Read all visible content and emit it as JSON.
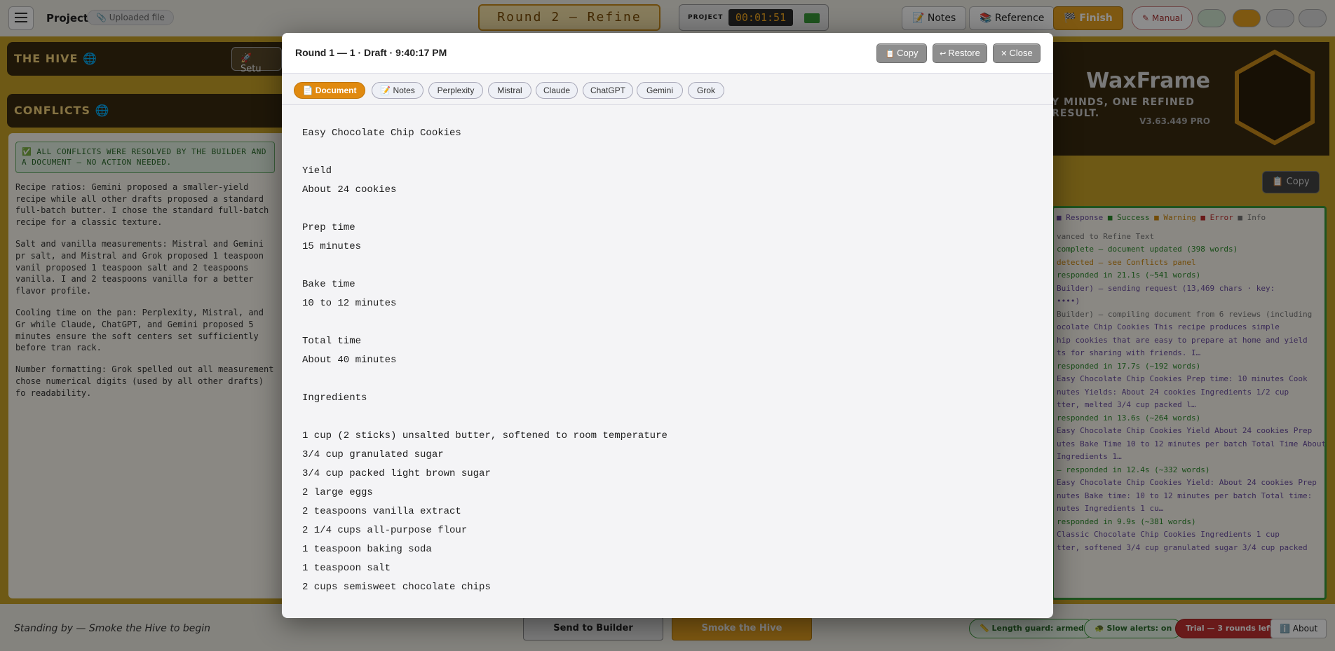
{
  "topbar": {
    "project_label": "Project",
    "uploaded_badge": "Uploaded file",
    "round_title": "Round 2 — Refine",
    "timer_label": "PROJECT",
    "timer_value": "00:01:51",
    "notes_label": "Notes",
    "reference_label": "Reference",
    "finish_label": "Finish",
    "manual_label": "Manual"
  },
  "left_panel": {
    "hive_title": "THE HIVE",
    "setup_label": "Setu",
    "conflicts_title": "CONFLICTS",
    "resolved_banner": "ALL CONFLICTS WERE RESOLVED BY THE BUILDER AND A DOCUMENT — NO ACTION NEEDED.",
    "paragraphs": [
      "Recipe ratios: Gemini proposed a smaller-yield recipe while all other drafts proposed a standard full-batch butter. I chose the standard full-batch recipe for a classic texture.",
      "Salt and vanilla measurements: Mistral and Gemini pr salt, and Mistral and Grok proposed 1 teaspoon vanil proposed 1 teaspoon salt and 2 teaspoons vanilla. I and 2 teaspoons vanilla for a better flavor profile.",
      "Cooling time on the pan: Perplexity, Mistral, and Gr while Claude, ChatGPT, and Gemini proposed 5 minutes ensure the soft centers set sufficiently before tran rack.",
      "Number formatting: Grok spelled out all measurement chose numerical digits (used by all other drafts) fo readability."
    ]
  },
  "right_panel": {
    "brand_name": "WaxFrame",
    "tagline": "Y MINDS, ONE REFINED RESULT.",
    "version": "V3.63.449 PRO",
    "copy_label": "Copy",
    "legend": {
      "response": "Response",
      "success": "Success",
      "warning": "Warning",
      "error": "Error",
      "info": "Info"
    },
    "log_lines": [
      {
        "cls": "c-info",
        "text": "vanced to Refine Text"
      },
      {
        "cls": "c-succ",
        "text": "complete — document updated (398 words)"
      },
      {
        "cls": "c-warn",
        "text": "detected — see Conflicts panel"
      },
      {
        "cls": "c-succ",
        "text": "responded in 21.1s (~541 words)"
      },
      {
        "cls": "c-resp",
        "text": "Builder) — sending request (13,469 chars · key:"
      },
      {
        "cls": "c-resp",
        "text": "••••)"
      },
      {
        "cls": "c-info",
        "text": "Builder) — compiling document from 6 reviews (including"
      },
      {
        "cls": "c-resp",
        "text": "ocolate Chip Cookies This recipe produces simple"
      },
      {
        "cls": "c-resp",
        "text": "hip cookies that are easy to prepare at home and yield"
      },
      {
        "cls": "c-resp",
        "text": "ts for sharing with friends. I…"
      },
      {
        "cls": "c-succ",
        "text": "responded in 17.7s (~192 words)"
      },
      {
        "cls": "c-resp",
        "text": "Easy Chocolate Chip Cookies Prep time: 10 minutes Cook"
      },
      {
        "cls": "c-resp",
        "text": "nutes Yields: About 24 cookies Ingredients 1/2 cup"
      },
      {
        "cls": "c-resp",
        "text": "tter, melted 3/4 cup packed l…"
      },
      {
        "cls": "c-succ",
        "text": "responded in 13.6s (~264 words)"
      },
      {
        "cls": "c-resp",
        "text": "Easy Chocolate Chip Cookies Yield About 24 cookies Prep"
      },
      {
        "cls": "c-resp",
        "text": "utes Bake Time 10 to 12 minutes per batch Total Time About"
      },
      {
        "cls": "c-resp",
        "text": "Ingredients 1…"
      },
      {
        "cls": "c-succ",
        "text": "— responded in 12.4s (~332 words)"
      },
      {
        "cls": "c-resp",
        "text": "Easy Chocolate Chip Cookies Yield: About 24 cookies Prep"
      },
      {
        "cls": "c-resp",
        "text": "nutes Bake time: 10 to 12 minutes per batch Total time:"
      },
      {
        "cls": "c-resp",
        "text": "nutes Ingredients 1 cu…"
      },
      {
        "cls": "c-succ",
        "text": "responded in 9.9s (~381 words)"
      },
      {
        "cls": "c-resp",
        "text": "Classic Chocolate Chip Cookies Ingredients 1 cup"
      },
      {
        "cls": "c-resp",
        "text": "tter, softened 3/4 cup granulated sugar 3/4 cup packed"
      }
    ]
  },
  "bottombar": {
    "standby_text": "Standing by — Smoke the Hive to begin",
    "send_label": "Send to Builder",
    "smoke_label": "Smoke the Hive",
    "length_guard": "Length guard: armed",
    "slow_alerts": "Slow alerts: on",
    "trial": "Trial — 3 rounds left",
    "about": "About"
  },
  "modal": {
    "title": "Round 1 — 1 · Draft · 9:40:17 PM",
    "copy_label": "Copy",
    "restore_label": "Restore",
    "close_label": "Close",
    "tabs": [
      {
        "label": "Document",
        "icon": "document-icon"
      },
      {
        "label": "Notes",
        "icon": "notes-icon"
      },
      {
        "label": "Perplexity"
      },
      {
        "label": "Mistral"
      },
      {
        "label": "Claude"
      },
      {
        "label": "ChatGPT"
      },
      {
        "label": "Gemini"
      },
      {
        "label": "Grok"
      }
    ],
    "document_lines": [
      "Easy Chocolate Chip Cookies",
      "",
      "Yield",
      "About 24 cookies",
      "",
      "Prep time",
      "15 minutes",
      "",
      "Bake time",
      "10 to 12 minutes",
      "",
      "Total time",
      "About 40 minutes",
      "",
      "Ingredients",
      "",
      "1 cup (2 sticks) unsalted butter, softened to room temperature",
      "3/4 cup granulated sugar",
      "3/4 cup packed light brown sugar",
      "2 large eggs",
      "2 teaspoons vanilla extract",
      "2 1/4 cups all-purpose flour",
      "1 teaspoon baking soda",
      "1 teaspoon salt",
      "2 cups semisweet chocolate chips"
    ]
  },
  "colors": {
    "accent": "#e08a10",
    "honey": "#c9a227",
    "success": "#3a9a3a",
    "trial": "#c03030"
  }
}
